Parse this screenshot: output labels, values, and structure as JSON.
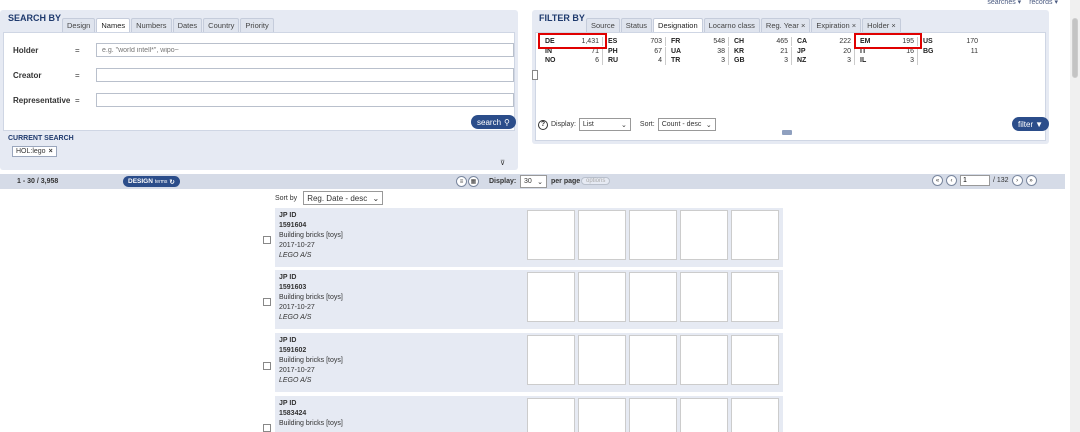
{
  "top_links": [
    "searches ▾",
    "records ▾"
  ],
  "search_by": {
    "title": "SEARCH BY",
    "tabs": [
      "Design",
      "Names",
      "Numbers",
      "Dates",
      "Country",
      "Priority"
    ],
    "active_tab": "Names",
    "fields": [
      {
        "label": "Holder",
        "eq": "=",
        "value": "",
        "placeholder": "e.g. \"world intell*\", wipo~"
      },
      {
        "label": "Creator",
        "eq": "=",
        "value": "",
        "placeholder": ""
      },
      {
        "label": "Representative",
        "eq": "=",
        "value": "",
        "placeholder": ""
      }
    ],
    "search_button": "search"
  },
  "current_search": {
    "label": "CURRENT SEARCH",
    "chip_text": "HOL:lego",
    "chip_close": "×"
  },
  "filter_by": {
    "title": "FILTER BY",
    "tabs": [
      "Source",
      "Status",
      "Designation",
      "Locarno class",
      "Reg. Year ×",
      "Expiration ×",
      "Holder ×"
    ],
    "active_tab": "Designation",
    "rows": [
      [
        {
          "code": "DE",
          "count": "1,431"
        },
        {
          "code": "ES",
          "count": "703"
        },
        {
          "code": "FR",
          "count": "548"
        },
        {
          "code": "CH",
          "count": "465"
        },
        {
          "code": "CA",
          "count": "222"
        },
        {
          "code": "EM",
          "count": "195"
        },
        {
          "code": "US",
          "count": "170"
        }
      ],
      [
        {
          "code": "IN",
          "count": "71"
        },
        {
          "code": "PH",
          "count": "67"
        },
        {
          "code": "UA",
          "count": "38"
        },
        {
          "code": "KR",
          "count": "21"
        },
        {
          "code": "JP",
          "count": "20"
        },
        {
          "code": "IT",
          "count": "16"
        },
        {
          "code": "BG",
          "count": "11"
        }
      ],
      [
        {
          "code": "NO",
          "count": "6"
        },
        {
          "code": "RU",
          "count": "4"
        },
        {
          "code": "TR",
          "count": "3"
        },
        {
          "code": "GB",
          "count": "3"
        },
        {
          "code": "NZ",
          "count": "3"
        },
        {
          "code": "IL",
          "count": "3"
        }
      ]
    ],
    "display_label": "Display:",
    "display_value": "List",
    "sort_label": "Sort:",
    "sort_value": "Count - desc",
    "filter_button": "filter",
    "highlight_color": "#e00000"
  },
  "results": {
    "range": "1 - 30 / 3,958",
    "design_label": "DESIGN",
    "design_sub": "terms",
    "display_label": "Display:",
    "per_page_value": "30",
    "per_page_label": "per page",
    "options_label": "options",
    "page_value": "1",
    "page_total": "/ 132"
  },
  "sort": {
    "label": "Sort by",
    "value": "Reg. Date - desc"
  },
  "records": [
    {
      "id_label": "JP ID",
      "id": "1591604",
      "product": "Building bricks [toys]",
      "date": "2017-10-27",
      "holder": "LEGO A/S"
    },
    {
      "id_label": "JP ID",
      "id": "1591603",
      "product": "Building bricks [toys]",
      "date": "2017-10-27",
      "holder": "LEGO A/S"
    },
    {
      "id_label": "JP ID",
      "id": "1591602",
      "product": "Building bricks [toys]",
      "date": "2017-10-27",
      "holder": "LEGO A/S"
    },
    {
      "id_label": "JP ID",
      "id": "1583424",
      "product": "Building bricks [toys]",
      "date": "",
      "holder": ""
    }
  ],
  "colors": {
    "accent": "#2b4d8a",
    "panel": "#e6eaf3",
    "title": "#1f3a6e"
  }
}
